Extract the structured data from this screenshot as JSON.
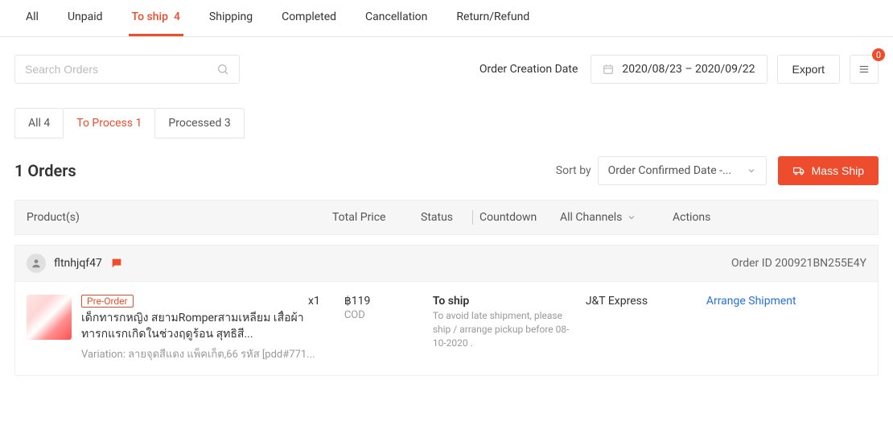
{
  "topTabs": [
    {
      "label": "All"
    },
    {
      "label": "Unpaid"
    },
    {
      "label": "To ship",
      "count": 4,
      "active": true
    },
    {
      "label": "Shipping"
    },
    {
      "label": "Completed"
    },
    {
      "label": "Cancellation"
    },
    {
      "label": "Return/Refund"
    }
  ],
  "search": {
    "placeholder": "Search Orders"
  },
  "creationLabel": "Order Creation Date",
  "dateRange": "2020/08/23 – 2020/09/22",
  "exportLabel": "Export",
  "notificationBadge": "0",
  "subTabs": [
    {
      "label": "All 4"
    },
    {
      "label": "To Process 1",
      "active": true
    },
    {
      "label": "Processed 3"
    }
  ],
  "ordersTitle": "1 Orders",
  "sortLabel": "Sort by",
  "sortValue": "Order Confirmed Date -...",
  "massShipLabel": "Mass Ship",
  "columns": {
    "products": "Product(s)",
    "totalPrice": "Total Price",
    "status": "Status",
    "countdown": "Countdown",
    "channel": "All Channels",
    "actions": "Actions"
  },
  "order": {
    "username": "fltnhjqf47",
    "orderIdLabel": "Order ID 200921BN255E4Y",
    "preorderBadge": "Pre-Order",
    "productName": "เด็กทารกหญิง สยามRomperสามเหลี่ยม เสื้อผ้าทารกแรกเกิดในช่วงฤดูร้อน สุทธิสี...",
    "variation": "Variation: ลายจุดสีแดง แพ็คเก็ต,66 รหัส [pdd#771...",
    "qty": "x1",
    "price": "฿119",
    "paymentMethod": "COD",
    "statusTitle": "To ship",
    "statusDetail": "To avoid late shipment, please ship / arrange pickup before 08-10-2020 .",
    "channel": "J&T Express",
    "actionLabel": "Arrange Shipment"
  }
}
